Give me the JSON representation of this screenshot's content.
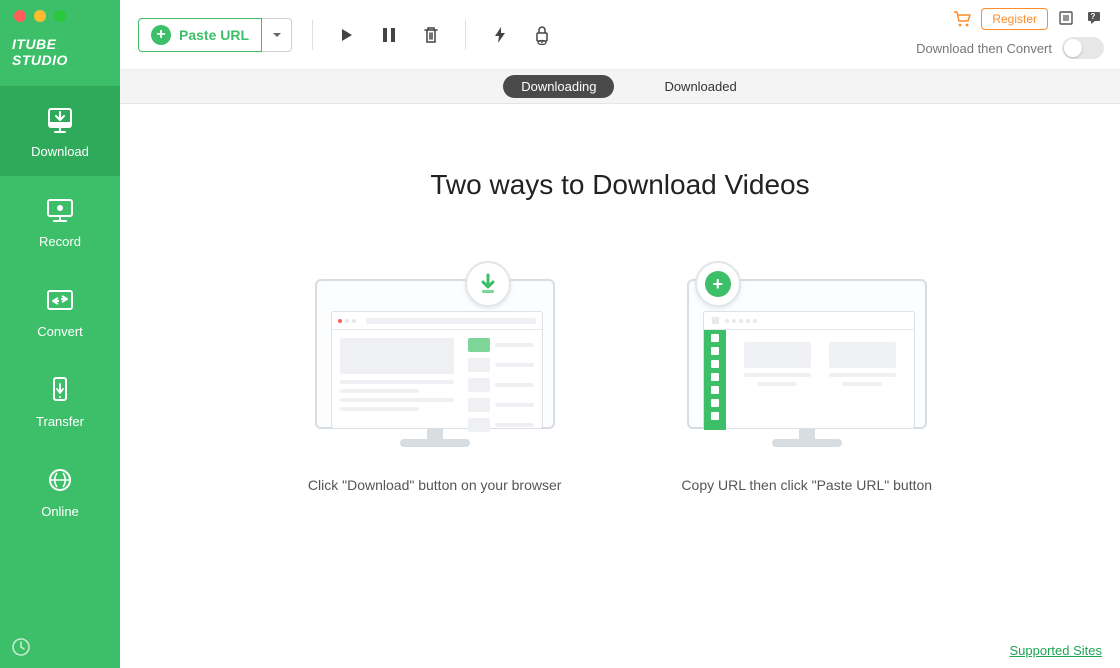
{
  "app": {
    "brand": "ITUBE STUDIO"
  },
  "sidebar": {
    "items": [
      {
        "label": "Download"
      },
      {
        "label": "Record"
      },
      {
        "label": "Convert"
      },
      {
        "label": "Transfer"
      },
      {
        "label": "Online"
      }
    ]
  },
  "toolbar": {
    "paste_label": "Paste URL",
    "convert_then": "Download then Convert"
  },
  "topright": {
    "register": "Register"
  },
  "tabs": {
    "downloading": "Downloading",
    "downloaded": "Downloaded"
  },
  "content": {
    "heading": "Two ways to Download Videos",
    "caption1": "Click \"Download\" button on your browser",
    "caption2": "Copy URL then click \"Paste URL\" button"
  },
  "footer": {
    "supported_sites": "Supported Sites"
  }
}
